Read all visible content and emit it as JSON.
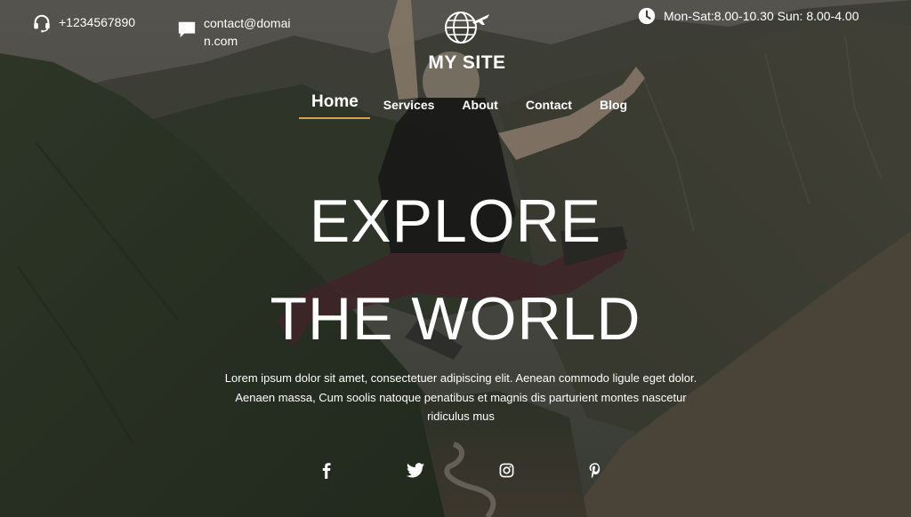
{
  "site": {
    "name": "MY SITE",
    "logo_icon": "globe-plane-icon"
  },
  "contact": {
    "phone": "+1234567890",
    "phone_icon": "headset-icon",
    "email": "contact@domain.com",
    "email_icon": "chat-bubble-icon",
    "hours": "Mon-Sat:8.00-10.30 Sun: 8.00-4.00",
    "hours_icon": "clock-icon"
  },
  "nav": {
    "items": [
      {
        "label": "Home",
        "active": true
      },
      {
        "label": "Services",
        "active": false
      },
      {
        "label": "About",
        "active": false
      },
      {
        "label": "Contact",
        "active": false
      },
      {
        "label": "Blog",
        "active": false
      }
    ],
    "active_underline_color": "#d9a24a"
  },
  "hero": {
    "line1": "EXPLORE",
    "line2": "THE WORLD",
    "text": "Lorem ipsum dolor sit amet, consectetuer adipiscing elit. Aenean commodo ligule eget dolor. Aenaen massa, Cum soolis natoque penatibus et magnis dis parturient montes nascetur ridiculus mus"
  },
  "social": [
    {
      "icon": "facebook-icon"
    },
    {
      "icon": "twitter-icon"
    },
    {
      "icon": "instagram-icon"
    },
    {
      "icon": "pinterest-icon"
    }
  ]
}
